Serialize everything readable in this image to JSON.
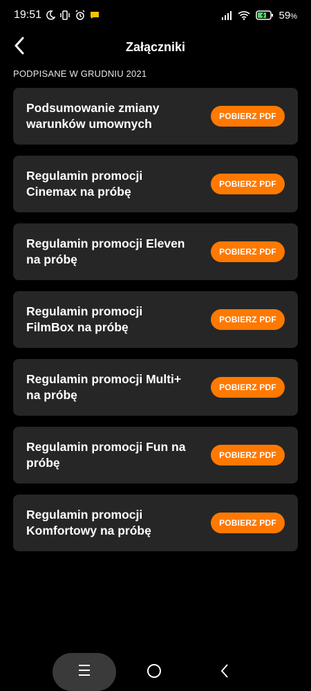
{
  "status_bar": {
    "time": "19:51",
    "battery": "59",
    "battery_unit": "%"
  },
  "header": {
    "title": "Załączniki"
  },
  "section": {
    "label": "PODPISANE W GRUDNIU 2021"
  },
  "items": [
    {
      "title": "Podsumowanie zmiany warunków umownych",
      "button": "POBIERZ PDF"
    },
    {
      "title": "Regulamin promocji Cinemax na próbę",
      "button": "POBIERZ PDF"
    },
    {
      "title": "Regulamin promocji Eleven na próbę",
      "button": "POBIERZ PDF"
    },
    {
      "title": "Regulamin promocji FilmBox na próbę",
      "button": "POBIERZ PDF"
    },
    {
      "title": "Regulamin promocji Multi+ na próbę",
      "button": "POBIERZ PDF"
    },
    {
      "title": "Regulamin promocji Fun na próbę",
      "button": "POBIERZ PDF"
    },
    {
      "title": "Regulamin promocji Komfortowy na próbę",
      "button": "POBIERZ PDF"
    }
  ],
  "colors": {
    "accent": "#ff7900",
    "card": "#262626",
    "background": "#000000"
  },
  "icons": {
    "back": "chevron-left-icon",
    "nav_menu": "menu-icon",
    "nav_home": "home-circle-icon",
    "nav_back": "nav-back-icon"
  }
}
